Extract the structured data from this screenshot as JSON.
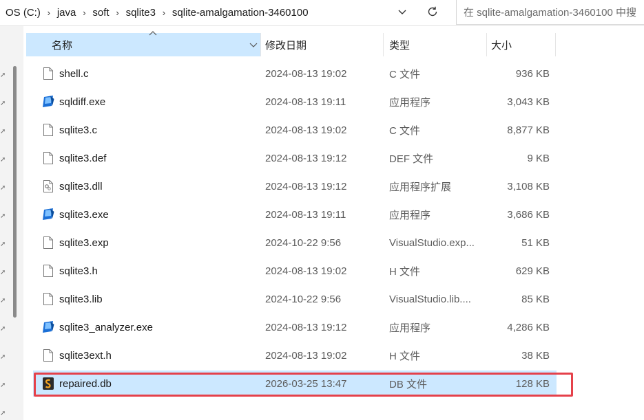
{
  "address": {
    "crumbs": [
      "OS (C:)",
      "java",
      "soft",
      "sqlite3",
      "sqlite-amalgamation-3460100"
    ],
    "search_placeholder": "在 sqlite-amalgamation-3460100 中搜"
  },
  "columns": {
    "name": "名称",
    "date": "修改日期",
    "type": "类型",
    "size": "大小"
  },
  "files": [
    {
      "name": "shell.c",
      "date": "2024-08-13 19:02",
      "type": "C 文件",
      "size": "936 KB",
      "icon": "text-file-icon"
    },
    {
      "name": "sqldiff.exe",
      "date": "2024-08-13 19:11",
      "type": "应用程序",
      "size": "3,043 KB",
      "icon": "exe-icon"
    },
    {
      "name": "sqlite3.c",
      "date": "2024-08-13 19:02",
      "type": "C 文件",
      "size": "8,877 KB",
      "icon": "text-file-icon"
    },
    {
      "name": "sqlite3.def",
      "date": "2024-08-13 19:12",
      "type": "DEF 文件",
      "size": "9 KB",
      "icon": "text-file-icon"
    },
    {
      "name": "sqlite3.dll",
      "date": "2024-08-13 19:12",
      "type": "应用程序扩展",
      "size": "3,108 KB",
      "icon": "dll-icon"
    },
    {
      "name": "sqlite3.exe",
      "date": "2024-08-13 19:11",
      "type": "应用程序",
      "size": "3,686 KB",
      "icon": "exe-icon"
    },
    {
      "name": "sqlite3.exp",
      "date": "2024-10-22 9:56",
      "type": "VisualStudio.exp...",
      "size": "51 KB",
      "icon": "text-file-icon"
    },
    {
      "name": "sqlite3.h",
      "date": "2024-08-13 19:02",
      "type": "H 文件",
      "size": "629 KB",
      "icon": "text-file-icon"
    },
    {
      "name": "sqlite3.lib",
      "date": "2024-10-22 9:56",
      "type": "VisualStudio.lib....",
      "size": "85 KB",
      "icon": "text-file-icon"
    },
    {
      "name": "sqlite3_analyzer.exe",
      "date": "2024-08-13 19:12",
      "type": "应用程序",
      "size": "4,286 KB",
      "icon": "exe-icon"
    },
    {
      "name": "sqlite3ext.h",
      "date": "2024-08-13 19:02",
      "type": "H 文件",
      "size": "38 KB",
      "icon": "text-file-icon"
    },
    {
      "name": "repaired.db",
      "date": "2026-03-25 13:47",
      "type": "DB 文件",
      "size": "128 KB",
      "icon": "db-icon",
      "selected": true
    }
  ],
  "colors": {
    "selection": "#cce8ff",
    "highlight_border": "#e5414a"
  }
}
